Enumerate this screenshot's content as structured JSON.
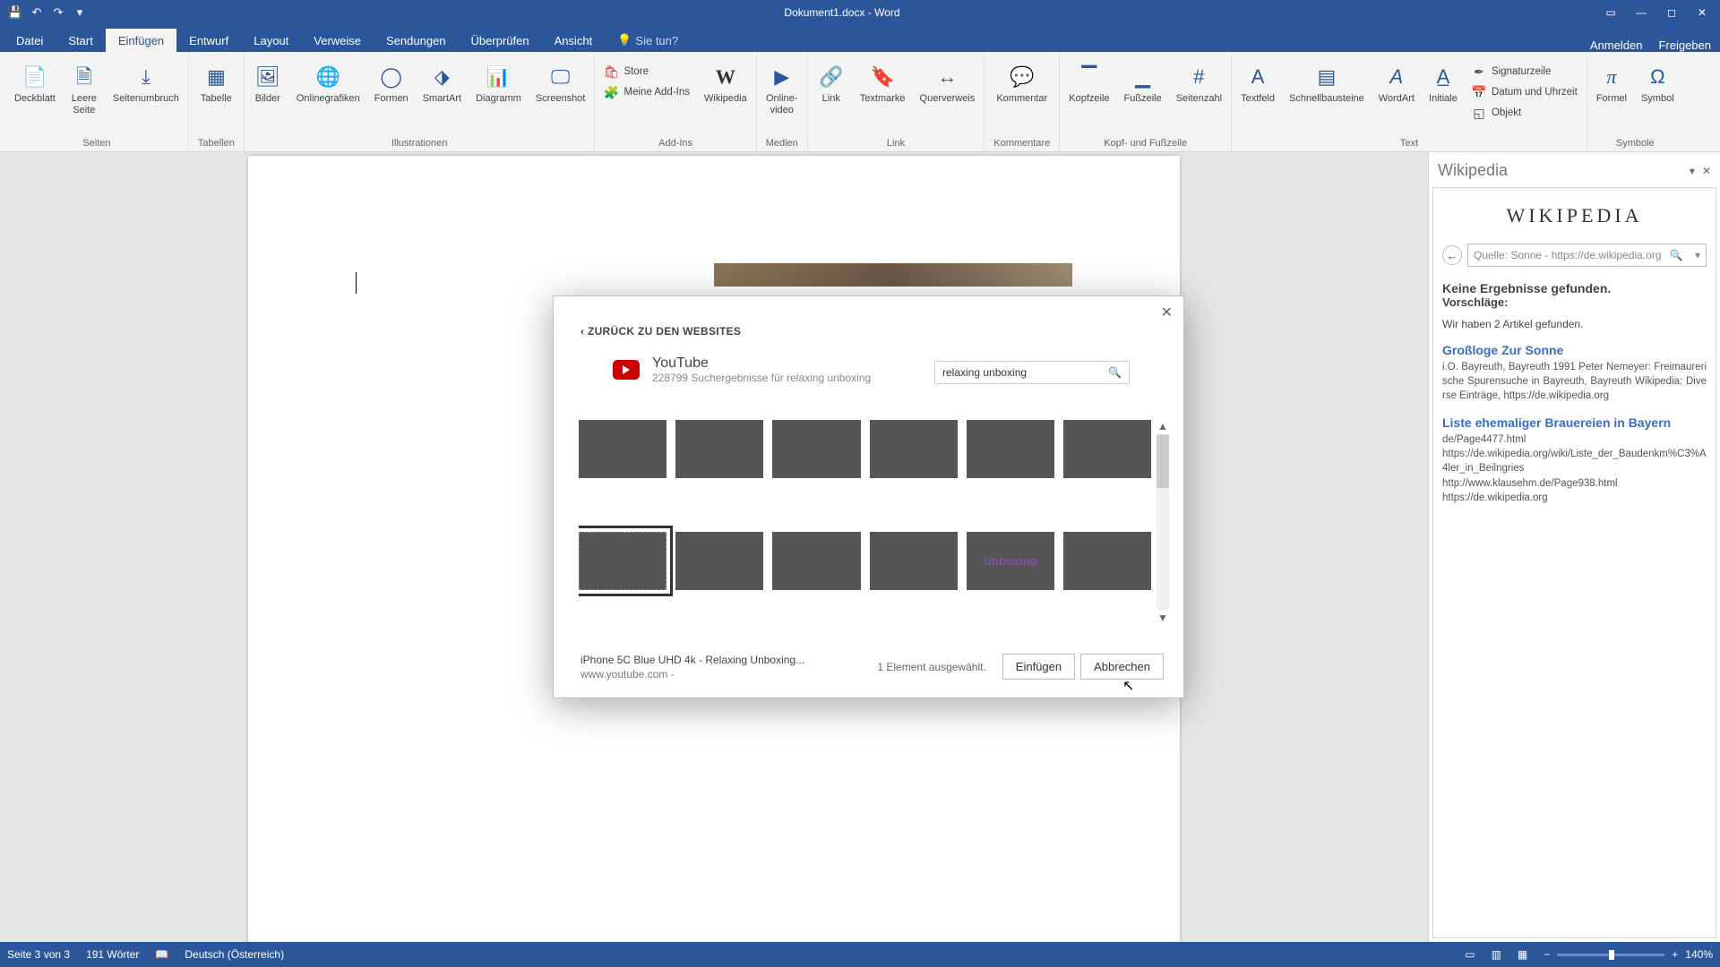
{
  "titlebar": {
    "title": "Dokument1.docx - Word"
  },
  "tabs": {
    "items": [
      "Datei",
      "Start",
      "Einfügen",
      "Entwurf",
      "Layout",
      "Verweise",
      "Sendungen",
      "Überprüfen",
      "Ansicht"
    ],
    "tell_me": "Sie tun?",
    "right": {
      "signin": "Anmelden",
      "share": "Freigeben"
    }
  },
  "ribbon": {
    "groups": {
      "seiten": {
        "label": "Seiten",
        "deckblatt": "Deckblatt",
        "leere": "Leere\nSeite",
        "umbruch": "Seitenumbruch"
      },
      "tabellen": {
        "label": "Tabellen",
        "tabelle": "Tabelle"
      },
      "ill": {
        "label": "Illustrationen",
        "bilder": "Bilder",
        "online": "Onlinegrafiken",
        "formen": "Formen",
        "smartart": "SmartArt",
        "diagramm": "Diagramm",
        "screenshot": "Screenshot"
      },
      "addins": {
        "label": "Add-Ins",
        "store": "Store",
        "mine": "Meine Add-Ins",
        "wiki": "Wikipedia"
      },
      "medien": {
        "label": "Medien",
        "video": "Online-\nvideo"
      },
      "link": {
        "label": "Link",
        "link": "Link",
        "textmarke": "Textmarke",
        "quer": "Querverweis"
      },
      "kommentare": {
        "label": "Kommentare",
        "kommentar": "Kommentar"
      },
      "kopf": {
        "label": "Kopf- und Fußzeile",
        "kopfzeile": "Kopfzeile",
        "fusszeile": "Fußzeile",
        "seitenzahl": "Seitenzahl"
      },
      "text": {
        "label": "Text",
        "textfeld": "Textfeld",
        "schnell": "Schnellbausteine",
        "wordart": "WordArt",
        "initiale": "Initiale",
        "sig": "Signaturzeile",
        "datum": "Datum und Uhrzeit",
        "objekt": "Objekt"
      },
      "symbole": {
        "label": "Symbole",
        "formel": "Formel",
        "symbol": "Symbol"
      }
    }
  },
  "taskpane": {
    "title": "Wikipedia",
    "logo": "WIKIPEDIA",
    "search_value": "Quelle: Sonne - https://de.wikipedia.org",
    "no_results": "Keine Ergebnisse gefunden.",
    "suggest": "Vorschläge:",
    "found": "Wir haben 2 Artikel gefunden.",
    "r1_title": "Großloge Zur Sonne",
    "r1_meta": "i.O. Bayreuth, Bayreuth 1991 Peter Nemeyer: Freimaurerische Spurensuche in Bayreuth, Bayreuth Wikipedia: Diverse Einträge, https://de.wikipedia.org",
    "r2_title": "Liste ehemaliger Brauereien in Bayern",
    "r2_meta": "de/Page4477.html\nhttps://de.wikipedia.org/wiki/Liste_der_Baudenkm%C3%A4ler_in_Beilngries\nhttp://www.klausehm.de/Page938.html\nhttps://de.wikipedia.org"
  },
  "status": {
    "page": "Seite 3 von 3",
    "words": "191 Wörter",
    "lang": "Deutsch (Österreich)",
    "zoom": "140%"
  },
  "modal": {
    "back": "ZURÜCK ZU DEN WEBSITES",
    "provider": "YouTube",
    "subtitle": "228799 Suchergebnisse für relaxing unboxing",
    "search_value": "relaxing unboxing",
    "thumb11_text": "Unboxing",
    "selected_title": "iPhone 5C Blue UHD 4k - Relaxing Unboxing...",
    "selected_source": "www.youtube.com -",
    "count": "1 Element ausgewählt.",
    "insert": "Einfügen",
    "cancel": "Abbrechen"
  }
}
